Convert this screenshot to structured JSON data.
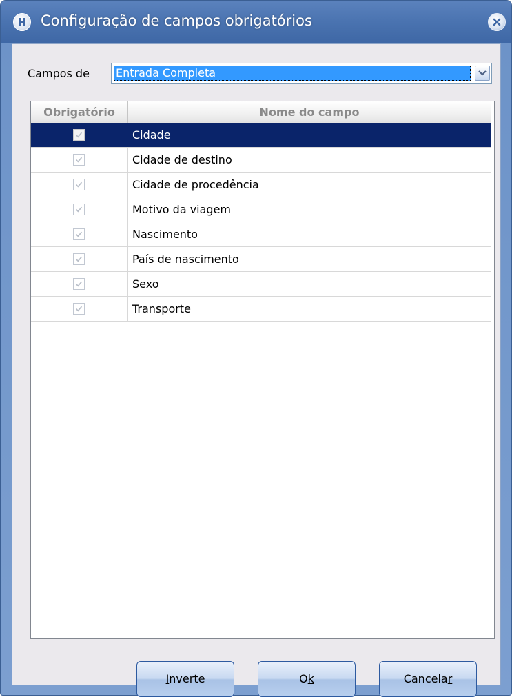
{
  "window": {
    "title": "Configuração de campos obrigatórios",
    "icon": "app-h-icon",
    "close_icon": "close-icon"
  },
  "form": {
    "campos_label": "Campos de",
    "campos_selected": "Entrada Completa"
  },
  "table": {
    "headers": [
      "Obrigatório",
      "Nome do campo"
    ],
    "rows": [
      {
        "checked": true,
        "name": "Cidade",
        "selected": true
      },
      {
        "checked": true,
        "name": "Cidade de destino",
        "selected": false
      },
      {
        "checked": true,
        "name": "Cidade de procedência",
        "selected": false
      },
      {
        "checked": true,
        "name": "Motivo da viagem",
        "selected": false
      },
      {
        "checked": true,
        "name": "Nascimento",
        "selected": false
      },
      {
        "checked": true,
        "name": "País de nascimento",
        "selected": false
      },
      {
        "checked": true,
        "name": "Sexo",
        "selected": false
      },
      {
        "checked": true,
        "name": "Transporte",
        "selected": false
      }
    ]
  },
  "buttons": {
    "inverte": {
      "before": "",
      "mnemonic": "I",
      "after": "nverte"
    },
    "ok": {
      "before": "O",
      "mnemonic": "k",
      "after": ""
    },
    "cancelar": {
      "before": "Cancela",
      "mnemonic": "r",
      "after": ""
    }
  },
  "colors": {
    "selection": "#0a246a",
    "combo_highlight": "#3399ff",
    "title_bar": "#4a73b0"
  }
}
